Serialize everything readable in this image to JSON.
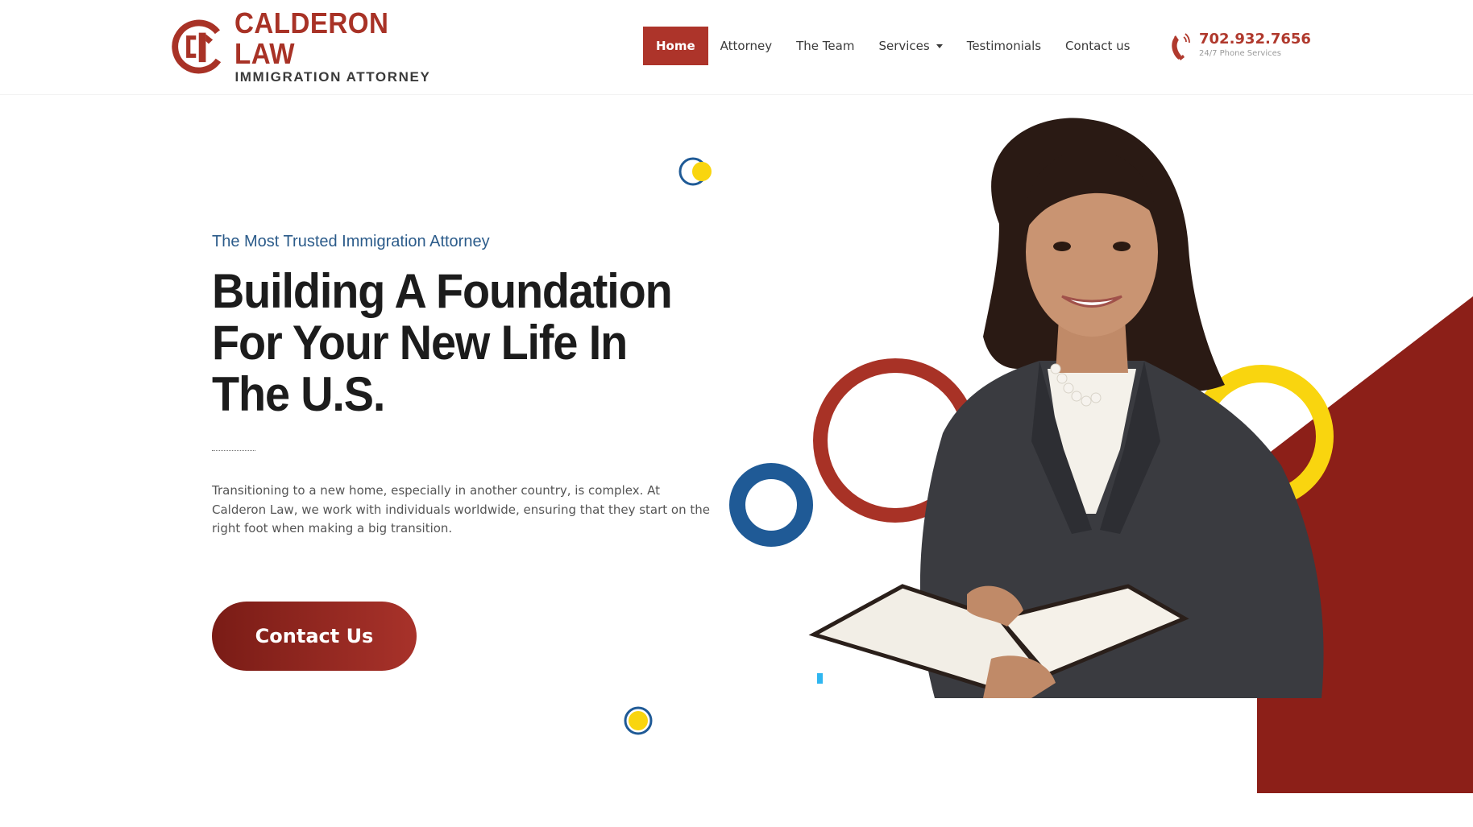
{
  "brand": {
    "name": "CALDERON LAW",
    "tagline": "IMMIGRATION ATTORNEY",
    "colors": {
      "primary": "#ad342a",
      "blue": "#1f5a96",
      "yellow": "#f9d50f"
    }
  },
  "nav": {
    "items": [
      {
        "label": "Home",
        "active": true
      },
      {
        "label": "Attorney"
      },
      {
        "label": "The Team"
      },
      {
        "label": "Services",
        "dropdown": true
      },
      {
        "label": "Testimonials"
      },
      {
        "label": "Contact us"
      }
    ]
  },
  "phone": {
    "number": "702.932.7656",
    "subtitle": "24/7 Phone Services",
    "icon": "phone-ringing-icon"
  },
  "hero": {
    "eyebrow": "The Most Trusted Immigration Attorney",
    "headline": "Building A Foundation For Your New Life In The U.S.",
    "body": "Transitioning to a new home, especially in another country, is complex. At Calderon Law, we work with individuals worldwide, ensuring that they start on the right foot when making a big transition.",
    "cta_label": "Contact Us"
  }
}
